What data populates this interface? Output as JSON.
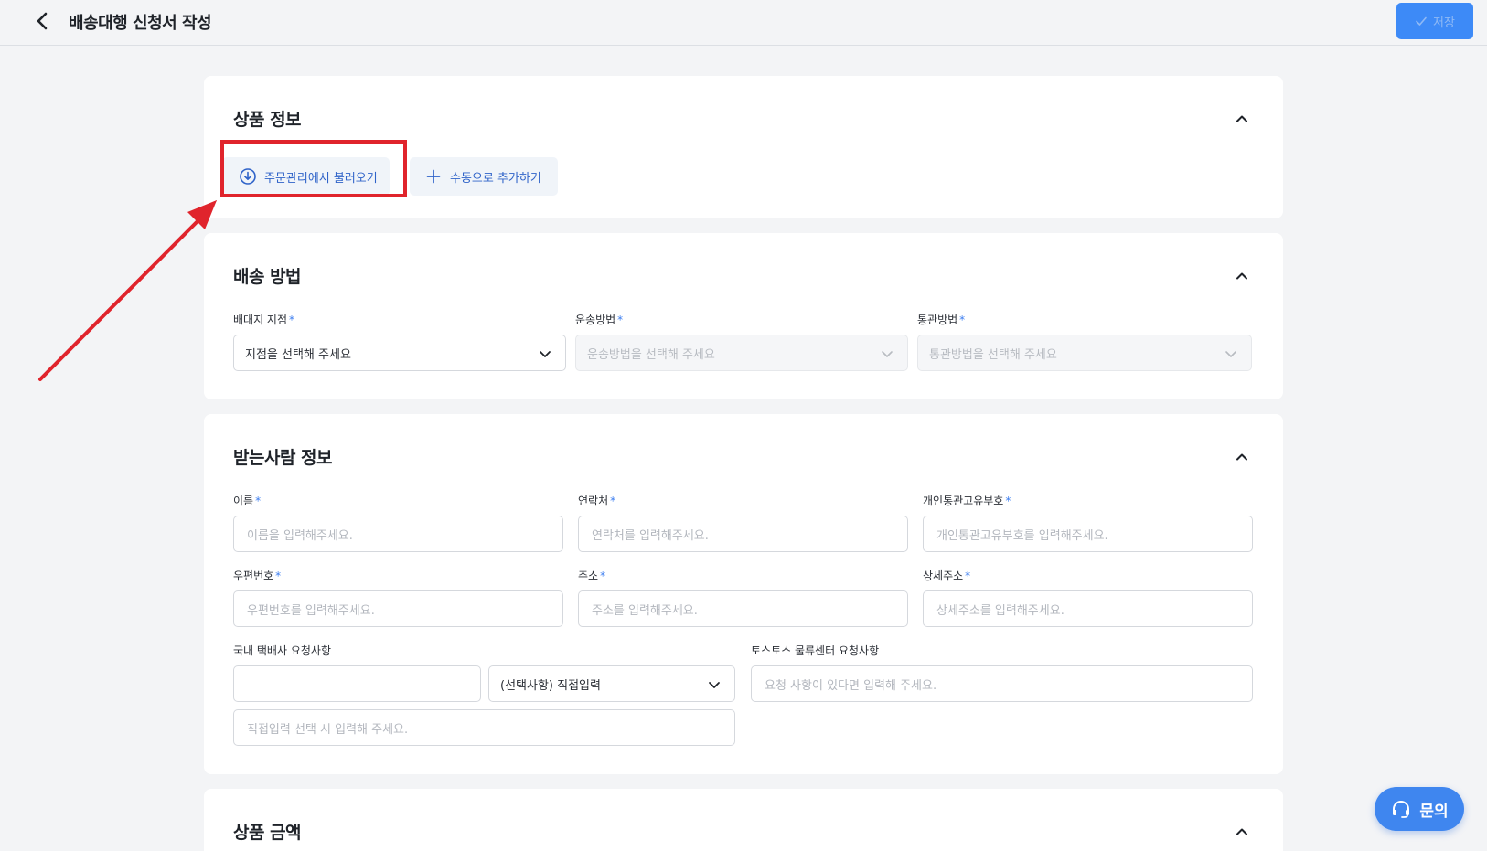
{
  "header": {
    "title": "배송대행 신청서 작성",
    "save_label": "저장"
  },
  "product_info": {
    "title": "상품 정보",
    "import_button": "주문관리에서 불러오기",
    "manual_button": "수동으로 추가하기"
  },
  "shipping_method": {
    "title": "배송 방법",
    "fields": [
      {
        "label": "배대지 지점",
        "placeholder": "지점을 선택해 주세요"
      },
      {
        "label": "운송방법",
        "placeholder": "운송방법을 선택해 주세요"
      },
      {
        "label": "통관방법",
        "placeholder": "통관방법을 선택해 주세요"
      }
    ]
  },
  "recipient": {
    "title": "받는사람 정보",
    "name": {
      "label": "이름",
      "placeholder": "이름을 입력해주세요."
    },
    "phone": {
      "label": "연락처",
      "placeholder": "연락처를 입력해주세요."
    },
    "customs_code": {
      "label": "개인통관고유부호",
      "placeholder": "개인통관고유부호를 입력해주세요."
    },
    "zipcode": {
      "label": "우편번호",
      "placeholder": "우편번호를 입력해주세요."
    },
    "address": {
      "label": "주소",
      "placeholder": "주소를 입력해주세요."
    },
    "address_detail": {
      "label": "상세주소",
      "placeholder": "상세주소를 입력해주세요."
    },
    "courier_request": {
      "label": "국내 택배사 요청사항",
      "select_value": "(선택사항) 직접입력",
      "direct_placeholder": "직접입력 선택 시 입력해 주세요."
    },
    "center_request": {
      "label": "토스토스 물류센터 요청사항",
      "placeholder": "요청 사항이 있다면 입력해 주세요."
    }
  },
  "product_amount": {
    "title": "상품 금액"
  },
  "required_mark": "*",
  "fab": {
    "label": "문의"
  },
  "colors": {
    "accent": "#3d8af7",
    "highlight": "#e0242c",
    "background": "#f3f4f6"
  }
}
